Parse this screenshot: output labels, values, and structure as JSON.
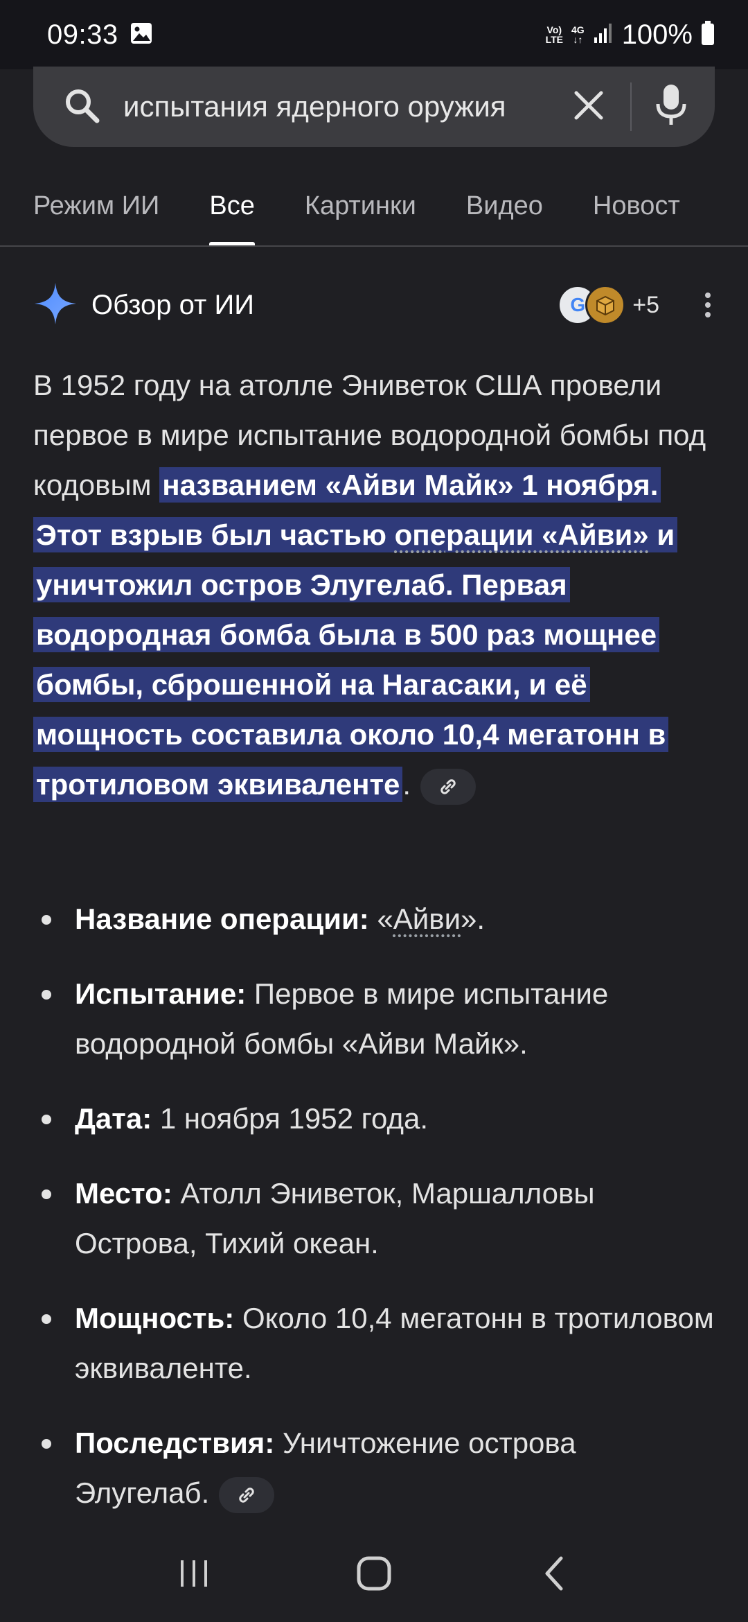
{
  "status_bar": {
    "time": "09:33",
    "volte_top": "Vo)",
    "volte_bottom": "LTE",
    "network": "4G",
    "battery": "100%"
  },
  "search": {
    "query": "испытания ядерного оружия",
    "icons": [
      "search-icon",
      "close-icon",
      "mic-icon"
    ]
  },
  "tabs": [
    {
      "label": "Режим ИИ"
    },
    {
      "label": "Все",
      "active": true
    },
    {
      "label": "Картинки"
    },
    {
      "label": "Видео"
    },
    {
      "label": "Новост"
    }
  ],
  "ai_overview": {
    "title": "Обзор от ИИ",
    "sources_more": "+5",
    "avatar_g": "G",
    "avatar_b": "",
    "paragraph_plain": "В 1952 году на атолле Эниветок США провели первое в мире испытание водородной бомбы под кодовым",
    "paragraph_hl_1": "названием «Айви Майк» 1 ноября. Этот взрыв был частью",
    "paragraph_hl_link": "операции «Айви»",
    "paragraph_hl_2": "и уничтожил остров Элугелаб. Первая водородная бомба была в 500 раз мощнее бомбы, сброшенной на Нагасаки, и её мощность составила около 10,4 мегатонн в тротиловом эквиваленте",
    "paragraph_end": "."
  },
  "bullets": [
    {
      "label": "Название операции:",
      "text_pre": "«",
      "link": "Айви",
      "text_post": "»."
    },
    {
      "label": "Испытание:",
      "text": "Первое в мире испытание водородной бомбы «Айви Майк»."
    },
    {
      "label": "Дата:",
      "text": "1 ноября 1952 года."
    },
    {
      "label": "Место:",
      "text": "Атолл Эниветок, Маршалловы Острова, Тихий океан."
    },
    {
      "label": "Мощность:",
      "text": "Около 10,4 мегатонн в тротиловом эквиваленте."
    },
    {
      "label": "Последствия:",
      "text": "Уничтожение острова Элугелаб."
    }
  ],
  "colors": {
    "background": "#1f1f23",
    "highlight": "#2f3a7a",
    "search_bg": "#3c3c40"
  }
}
